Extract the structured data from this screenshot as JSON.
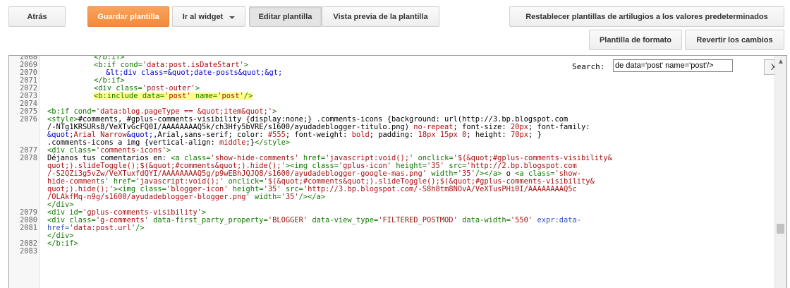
{
  "toolbar": {
    "back": "Atrás",
    "save_template": "Guardar plantilla",
    "go_to_widget": "Ir al widget",
    "edit_template": "Editar plantilla",
    "preview_template": "Vista previa de la plantilla",
    "reset_templates": "Restablecer plantillas de artilugios a los valores predeterminados",
    "format_template": "Plantilla de formato",
    "revert_changes": "Revertir los cambios"
  },
  "search": {
    "label": "Search:",
    "value": "de data='post' name='post'/>",
    "close": "X"
  },
  "line_numbers": [
    "2068",
    "2069",
    "2070",
    "2071",
    "2072",
    "2073",
    "2074",
    "2075",
    "2076",
    "2077",
    "2078",
    "2079",
    "2080",
    "2081",
    "2082",
    "2083"
  ],
  "code": {
    "l2068": "</b:if>",
    "l2069_tag": "<b:if ",
    "l2069_attr": "cond=",
    "l2069_val": "'data:post.isDateStart'",
    "l2069_end": ">",
    "l2070": "&lt;div class=&quot;date-posts&quot;&gt;",
    "l2071": "</b:if>",
    "l2072_tag": "<div ",
    "l2072_attr": "class=",
    "l2072_val": "'post-outer'",
    "l2072_end": ">",
    "l2073_tag": "<b:include ",
    "l2073_attr1": "data=",
    "l2073_val1": "'post'",
    "l2073_attr2": " name=",
    "l2073_val2": "'post'",
    "l2073_end": "/>",
    "l2075_tag": "<b:if ",
    "l2075_attr": "cond=",
    "l2075_val": "'data:blog.pageType == &quot;item&quot;'",
    "l2075_end": ">",
    "l2076_a": "<style>",
    "l2076_b": "#comments, #gplus-comments-visibility {display:none;} .comments-icons {background: url(http://3.bp.blogspot.com",
    "l2076_c": "/-NTg1KRSURs8/VeXTvGcFQ0I/AAAAAAAAQ5k/ch3Hfy5bVRE/s1600/ayudadeblogger-titulo.png) ",
    "l2076_d": "no-repeat",
    "l2076_e": "; font-size: ",
    "l2076_f": "20px",
    "l2076_g": "; font-family:",
    "l2076_h": "&quot;",
    "l2076_i": "Arial Narrow",
    "l2076_j": "&quot;",
    "l2076_k": ",Arial,sans-serif; color: ",
    "l2076_l": "#555",
    "l2076_m": "; font-weight: ",
    "l2076_n": "bold",
    "l2076_o": "; padding: ",
    "l2076_p": "18px 15px 0",
    "l2076_q": "; height: ",
    "l2076_r": "70px",
    "l2076_s": "; }",
    "l2076_t": ".comments-icons a img {vertical-align: ",
    "l2076_u": "middle",
    "l2076_v": ";}",
    "l2076_w": "</style>",
    "l2077_tag": "<div ",
    "l2077_attr": "class=",
    "l2077_val": "'comments-icons'",
    "l2077_end": ">",
    "l2078_1": "Déjanos tus comentarios en: ",
    "l2078_2": "<a ",
    "l2078_3": "class=",
    "l2078_4": "'show-hide-comments'",
    "l2078_5": " href=",
    "l2078_6": "'javascript:void();'",
    "l2078_7": " onclick=",
    "l2078_8": "'$(&quot;#gplus-comments-visibility&",
    "l2078_9": "quot;).slideToggle();$(&quot;#comments&quot;).hide();'",
    "l2078_10": "><img ",
    "l2078_11": "class=",
    "l2078_12": "'gplus-icon'",
    "l2078_13": " height=",
    "l2078_14": "'35'",
    "l2078_15": " src=",
    "l2078_16": "'http://2.bp.blogspot.com",
    "l2078_17": "/-S2QZi3g5vZw/VeXTuxfdQYI/AAAAAAAAQ5g/p9wEBhJQJQ8/s1600/ayudadeblogger-google-mas.png'",
    "l2078_18": " width=",
    "l2078_19": "'35'",
    "l2078_20": "/></a>",
    "l2078_21": " o ",
    "l2078_22": "<a ",
    "l2078_23": "class=",
    "l2078_24": "'show-",
    "l2078_25": "hide-comments'",
    "l2078_26": " href=",
    "l2078_27": "'javascript:void();'",
    "l2078_28": " onclick=",
    "l2078_29": "'$(&quot;#comments&quot;).slideToggle();$(&quot;#gplus-comments-visibility&",
    "l2078_30": "quot;).hide();'",
    "l2078_31": "><img ",
    "l2078_32": "class=",
    "l2078_33": "'blogger-icon'",
    "l2078_34": " height=",
    "l2078_35": "'35'",
    "l2078_36": " src=",
    "l2078_37": "'http://3.bp.blogspot.com/-S8h8tm8NOvA/VeXTusPHi0I/AAAAAAAAQ5c",
    "l2078_38": "/OLAkfMq-n9g/s1600/ayudadeblogger-blogger.png'",
    "l2078_39": " width=",
    "l2078_40": "'35'",
    "l2078_41": "/></a>",
    "l2079": "</div>",
    "l2080_tag": "<div ",
    "l2080_attr": "id=",
    "l2080_val": "'gplus-comments-visibility'",
    "l2080_end": ">",
    "l2081_tag": "<div ",
    "l2081_attr1": "class=",
    "l2081_val1": "'g-comments'",
    "l2081_attr2": " data-first_party_property=",
    "l2081_val2": "'BLOGGER'",
    "l2081_attr3": " data-view_type=",
    "l2081_val3": "'FILTERED_POSTMOD'",
    "l2081_attr4": " data-width=",
    "l2081_val4": "'550'",
    "l2081_expr": " expr:data-",
    "l2081_expr2": "href=",
    "l2081_val5": "'data:post.url'",
    "l2081_end": "/>",
    "l2082": "</div>",
    "l2083": "</b:if>"
  },
  "colors": {
    "tag": "#117700",
    "string": "#aa1111",
    "entity": "#0000cc",
    "highlight": "#ffff8a",
    "save_button": "#f48a3c"
  },
  "icons": {
    "dropdown": "chevron-down-icon",
    "scroll_up": "scroll-up-arrow-icon"
  }
}
